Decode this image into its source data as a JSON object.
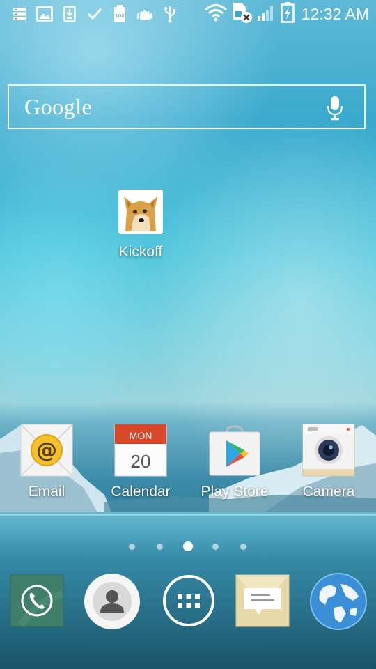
{
  "status_bar": {
    "time": "12:32 AM",
    "battery_level": "100",
    "left_icons": [
      "storage-icon",
      "gallery-icon",
      "download-icon",
      "check-icon",
      "battery-100-icon",
      "android-debug-icon",
      "usb-icon"
    ],
    "right_icons": [
      "wifi-icon",
      "sim-no-service-icon",
      "signal-icon",
      "battery-charging-icon"
    ]
  },
  "search": {
    "logo": "Google",
    "mic_icon": "microphone-icon"
  },
  "apps": {
    "kickoff": {
      "label": "Kickoff",
      "icon": "doge-icon"
    },
    "email": {
      "label": "Email",
      "icon": "email-icon"
    },
    "calendar": {
      "label": "Calendar",
      "icon": "calendar-icon",
      "month": "MON",
      "day": "20"
    },
    "play_store": {
      "label": "Play Store",
      "icon": "play-store-icon"
    },
    "camera": {
      "label": "Camera",
      "icon": "camera-icon"
    }
  },
  "pager": {
    "pages": 5,
    "current_page": 3
  },
  "dock": {
    "items": [
      "phone-icon",
      "contacts-icon",
      "app-drawer-icon",
      "messaging-icon",
      "browser-globe-icon"
    ]
  },
  "colors": {
    "calendar_header": "#d9482a",
    "phone_tile": "#3f7f6a",
    "message_tile": "#e8d9a8",
    "camera_body": "#e9d6b3"
  }
}
